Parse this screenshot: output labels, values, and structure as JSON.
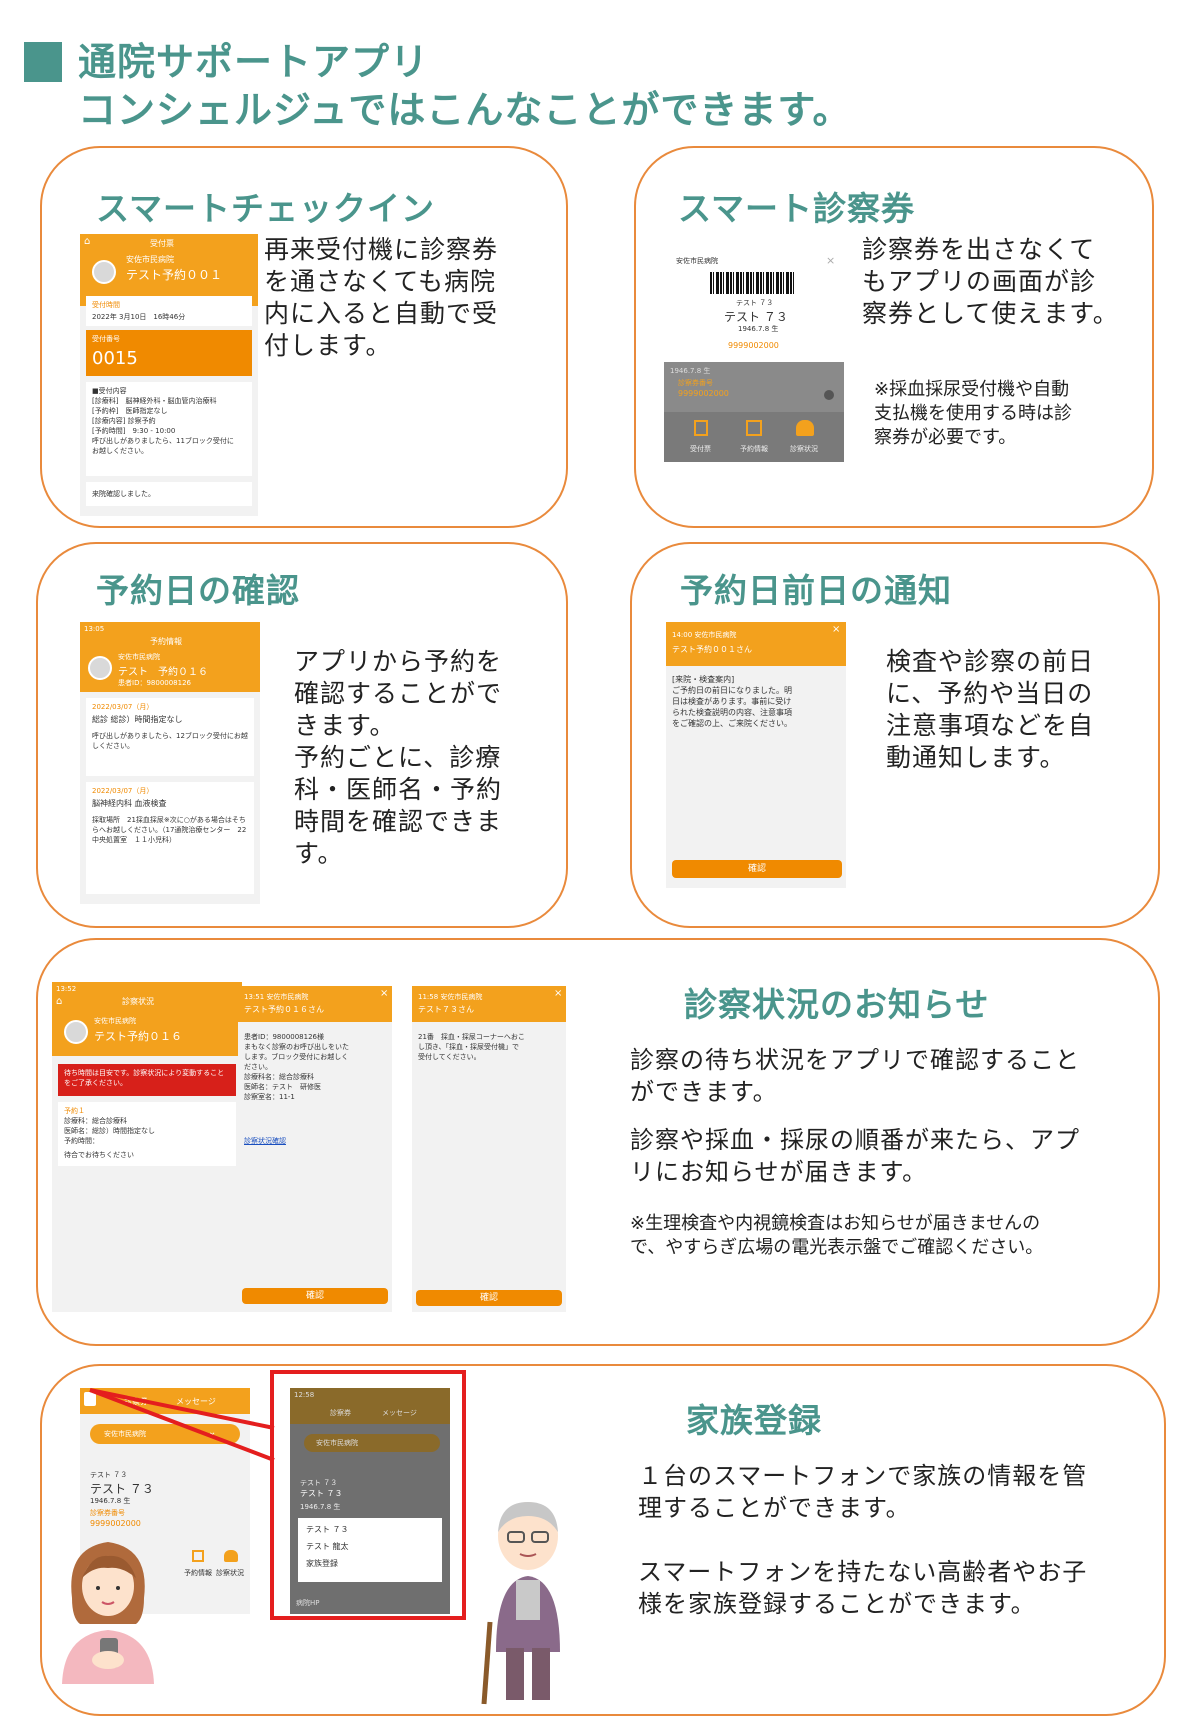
{
  "header": {
    "line1": "通院サポートアプリ",
    "line2": "コンシェルジュではこんなことができます。"
  },
  "checkin": {
    "title": "スマートチェックイン",
    "desc": [
      "再来受付機に診察券",
      "を通さなくても病院",
      "内に入ると自動で受",
      "付します。"
    ],
    "mock": {
      "header": "受付票",
      "hospital": "安佐市民病院",
      "patient": "テスト予約００１",
      "time_label": "受付時間",
      "time_value": "2022年 3月10日　16時46分",
      "number_label": "受付番号",
      "number_value": "0015",
      "content_lines": [
        "■受付内容",
        "[診療科]　脳神経外科・脳血管内治療科",
        "[予約枠]　医師指定なし",
        "[診療内容] 診察予約",
        "[予約時間]　9:30 - 10:00",
        "呼び出しがありましたら、11ブロック受付に",
        "お越しください。"
      ],
      "footer": "来院確認しました。"
    }
  },
  "card_ticket": {
    "title": "スマート診察券",
    "desc": [
      "診察券を出さなくて",
      "もアプリの画面が診",
      "察券として使えます。"
    ],
    "note": [
      "※採血採尿受付機や自動",
      "支払機を使用する時は診",
      "察券が必要です。"
    ],
    "mock": {
      "hospital": "安佐市民病院",
      "close": "×",
      "kana": "テスト ７３",
      "name": "テスト ７３",
      "dob": "1946.7.8 生",
      "number": "9999002000",
      "dob2": "1946.7.8 生",
      "num_label": "診察券番号",
      "num_value": "9999002000",
      "nav": [
        "受付票",
        "予約情報",
        "診察状況"
      ]
    }
  },
  "reservation": {
    "title": "予約日の確認",
    "desc": [
      "アプリから予約を",
      "確認することがで",
      "きます。",
      "予約ごとに、診療",
      "科・医師名・予約",
      "時間を確認できま",
      "す。"
    ],
    "mock": {
      "status": "13:05",
      "header": "予約情報",
      "hospital": "安佐市民病院",
      "patient": "テスト　予約０１６",
      "pid": "患者ID：9800008126",
      "r1_date": "2022/03/07（月）",
      "r1_title": "総診 総診）時間指定なし",
      "r1_note": "呼び出しがありましたら、12ブロック受付にお越しください。",
      "r2_date": "2022/03/07（月）",
      "r2_title": "脳神経内科 血液検査",
      "r2_note": "採取場所　21採血採尿※次に○がある場合はそちらへお越しください。（17通院治療センター　22中央処置室　１１小児科）"
    }
  },
  "notify": {
    "title": "予約日前日の通知",
    "desc": [
      "検査や診察の前日",
      "に、予約や当日の",
      "注意事項などを自",
      "動通知します。"
    ],
    "mock": {
      "time_hospital": "14:00 安佐市民病院",
      "patient": "テスト予約００１さん",
      "close": "×",
      "body": [
        "[来院・検査案内]",
        "ご予約日の前日になりました。明",
        "日は検査があります。事前に受け",
        "られた検査説明の内容、注意事項",
        "をご確認の上、ご来院ください。"
      ],
      "confirm": "確認"
    }
  },
  "status": {
    "title": "診察状況のお知らせ",
    "desc1": [
      "診察の待ち状況をアプリで確認すること",
      "ができます。"
    ],
    "desc2": [
      "診察や採血・採尿の順番が来たら、アプ",
      "リにお知らせが届きます。"
    ],
    "note": [
      "※生理検査や内視鏡検査はお知らせが届きませんの",
      "で、やすらぎ広場の電光表示盤でご確認ください。"
    ],
    "mock1": {
      "status": "13:52",
      "header": "診察状況",
      "hospital": "安佐市民病院",
      "patient": "テスト予約０１６",
      "alert": "待ち時間は目安です。診察状況により変動することをご了承ください。",
      "item_title": "予約１",
      "item_lines": [
        "診療科：総合診療科",
        "医師名：総診）時間指定なし",
        "予約時間："
      ],
      "item_wait": "待合でお待ちください"
    },
    "mock2": {
      "time_hospital": "13:51 安佐市民病院",
      "patient": "テスト予約０１６さん",
      "close": "×",
      "body": [
        "患者ID：9800008126様",
        "まもなく診察のお呼び出しをいた",
        "します。ブロック受付にお越しく",
        "ださい。",
        "診療科名：総合診療科",
        "医師名：テスト　研修医",
        "診察室名：11-1"
      ],
      "link": "診察状況確認",
      "confirm": "確認"
    },
    "mock3": {
      "time_hospital": "11:58 安佐市民病院",
      "patient": "テスト７３さん",
      "close": "×",
      "body": [
        "21番　採血・採尿コーナーへおこ",
        "し頂き、「採血・採尿受付機」で",
        "受付してください。"
      ],
      "confirm": "確認"
    }
  },
  "family": {
    "title": "家族登録",
    "desc1": [
      "１台のスマートフォンで家族の情報を管",
      "理することができます。"
    ],
    "desc2": [
      "スマートフォンを持たない高齢者やお子",
      "様を家族登録することができます。"
    ],
    "mock_left": {
      "tab1": "診察券",
      "tab2": "メッセージ",
      "hospital": "安佐市民病院",
      "kana": "テスト ７３",
      "name": "テスト ７３",
      "dob": "1946.7.8 生",
      "num_label": "診察券番号",
      "num_value": "9999002000",
      "nav": [
        "予約情報",
        "診察状況"
      ]
    },
    "mock_right": {
      "status": "12:58",
      "tab1": "診察券",
      "tab2": "メッセージ",
      "hospital": "安佐市民病院",
      "kana": "テスト ７３",
      "name": "テスト ７３",
      "dob": "1946.7.8 生",
      "menu": [
        "テスト ７３",
        "テスト 龍太",
        "家族登録"
      ],
      "footer": "病院HP"
    }
  },
  "colors": {
    "accent": "#4a958c",
    "border": "#e98a3c",
    "app_orange": "#f3a11d",
    "highlight": "#e41e1e"
  }
}
